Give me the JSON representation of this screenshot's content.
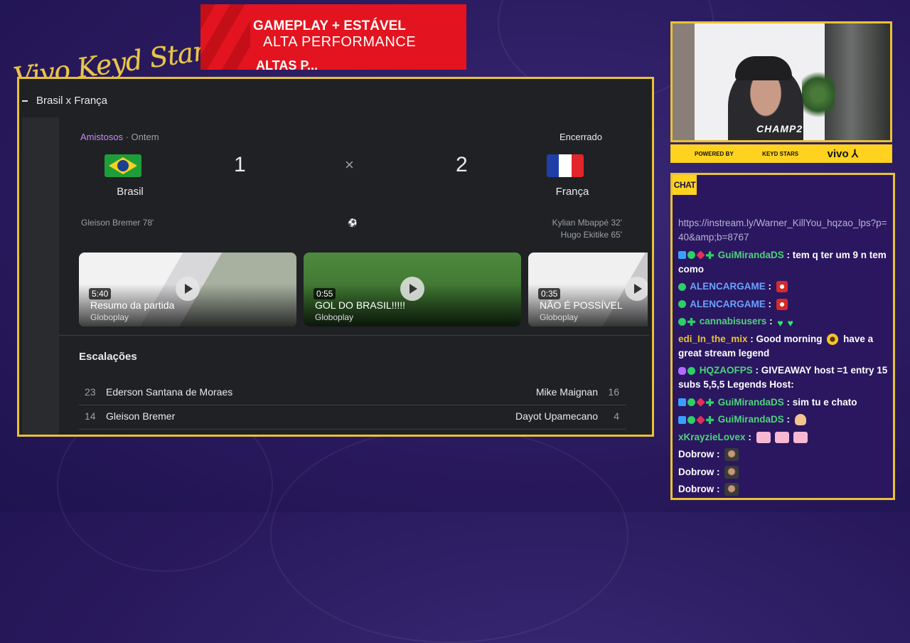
{
  "brand": {
    "script_text": "Vivo Keyd Stars",
    "color": "#e8c64a"
  },
  "banner": {
    "line1": "GAMEPLAY + ESTÁVEL",
    "line2": "ALTA PERFORMANCE",
    "line3": "ALTAS P...",
    "color": "#e3141f"
  },
  "browser": {
    "title": "Brasil x França",
    "match": {
      "competition": "Amistosos",
      "date": "· Ontem",
      "status": "Encerrado",
      "home": {
        "name": "Brasil",
        "score": "1",
        "scorers": [
          "Gleison Bremer 78'"
        ]
      },
      "away": {
        "name": "França",
        "score": "2",
        "scorers": [
          "Kylian Mbappé 32'",
          "Hugo Ekitike 65'"
        ]
      },
      "vs": "×"
    },
    "videos": [
      {
        "duration": "5:40",
        "title": "Resumo da partida",
        "source": "Globoplay"
      },
      {
        "duration": "0:55",
        "title": "GOL DO BRASIL!!!!!",
        "source": "Globoplay"
      },
      {
        "duration": "0:35",
        "title": "NÃO É POSSÍVEL",
        "source": "Globoplay"
      }
    ],
    "lineups": {
      "title": "Escalações",
      "rows": [
        {
          "home_num": "23",
          "home_player": "Ederson Santana de Moraes",
          "away_player": "Mike Maignan",
          "away_num": "16"
        },
        {
          "home_num": "14",
          "home_player": "Gleison Bremer",
          "away_player": "Dayot Upamecano",
          "away_num": "4"
        }
      ]
    }
  },
  "webcam": {
    "overlay_text": "CHAMP2"
  },
  "sponsor_bar": {
    "powered": "POWERED BY",
    "keyd": "KEYD STARS",
    "vivo": "vivo ⅄"
  },
  "chat": {
    "tab_label": "CHAT",
    "messages": [
      {
        "user": "",
        "text": "https://instream.ly/Warner_KillYou_hqzao_lps?p=40&amp;b=8767"
      },
      {
        "user": "GuiMirandaDS",
        "text": "tem q ter um 9 n tem como"
      },
      {
        "user": "ALENCARGAME",
        "text": ""
      },
      {
        "user": "ALENCARGAME",
        "text": ""
      },
      {
        "user": "cannabisusers",
        "text": ""
      },
      {
        "user": "edi_In_the_mix",
        "text": "Good morning",
        "text2": "have a great stream legend"
      },
      {
        "user": "HQZAOFPS",
        "text": "GIVEAWAY host =1 entry 15 subs 5,5,5 Legends Host:"
      },
      {
        "user": "GuiMirandaDS",
        "text": "sim tu e chato"
      },
      {
        "user": "GuiMirandaDS",
        "text": ""
      },
      {
        "user": "xKrayzieLovex",
        "text": ""
      },
      {
        "user": "Dobrow",
        "text": ""
      },
      {
        "user": "Dobrow",
        "text": ""
      },
      {
        "user": "Dobrow",
        "text": ""
      }
    ]
  }
}
